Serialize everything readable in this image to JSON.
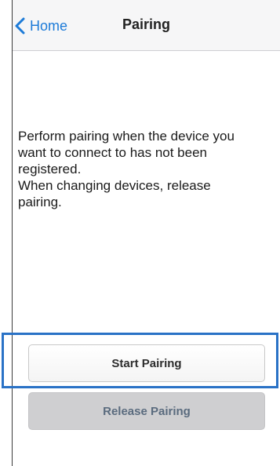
{
  "nav": {
    "back_label": "Home",
    "back_icon": "chevron-left-icon",
    "title": "Pairing",
    "accent_color": "#1d7bd8"
  },
  "message": {
    "line1": "Perform pairing when the device you want to connect to has not been registered.",
    "line2": "When changing devices, release pairing."
  },
  "buttons": {
    "start_label": "Start Pairing",
    "release_label": "Release Pairing"
  },
  "highlight_color": "#2a72c6"
}
